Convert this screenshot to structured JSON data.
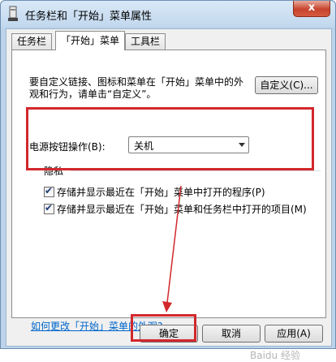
{
  "window": {
    "title": "任务栏和「开始」菜单属性",
    "close_label": "x"
  },
  "tabs": [
    {
      "label": "任务栏",
      "active": false
    },
    {
      "label": "「开始」菜单",
      "active": true
    },
    {
      "label": "工具栏",
      "active": false
    }
  ],
  "start_menu": {
    "description": "要自定义链接、图标和菜单在「开始」菜单中的外观和行为，请单击“自定义”。",
    "customize_button": "自定义(C)...",
    "power_label": "电源按钮操作(B):",
    "power_value": "关机"
  },
  "privacy": {
    "title": "隐私",
    "items": [
      {
        "label": "存储并显示最近在「开始」菜单中打开的程序(P)",
        "checked": true
      },
      {
        "label": "存储并显示最近在「开始」菜单和任务栏中打开的项目(M)",
        "checked": true
      }
    ]
  },
  "help_link": "如何更改「开始」菜单的外观?",
  "buttons": {
    "ok": "确定",
    "cancel": "取消",
    "apply": "应用(A)"
  },
  "watermark": "Baidu 经验",
  "colors": {
    "annotation": "#d2282c",
    "link": "#0066cc"
  }
}
